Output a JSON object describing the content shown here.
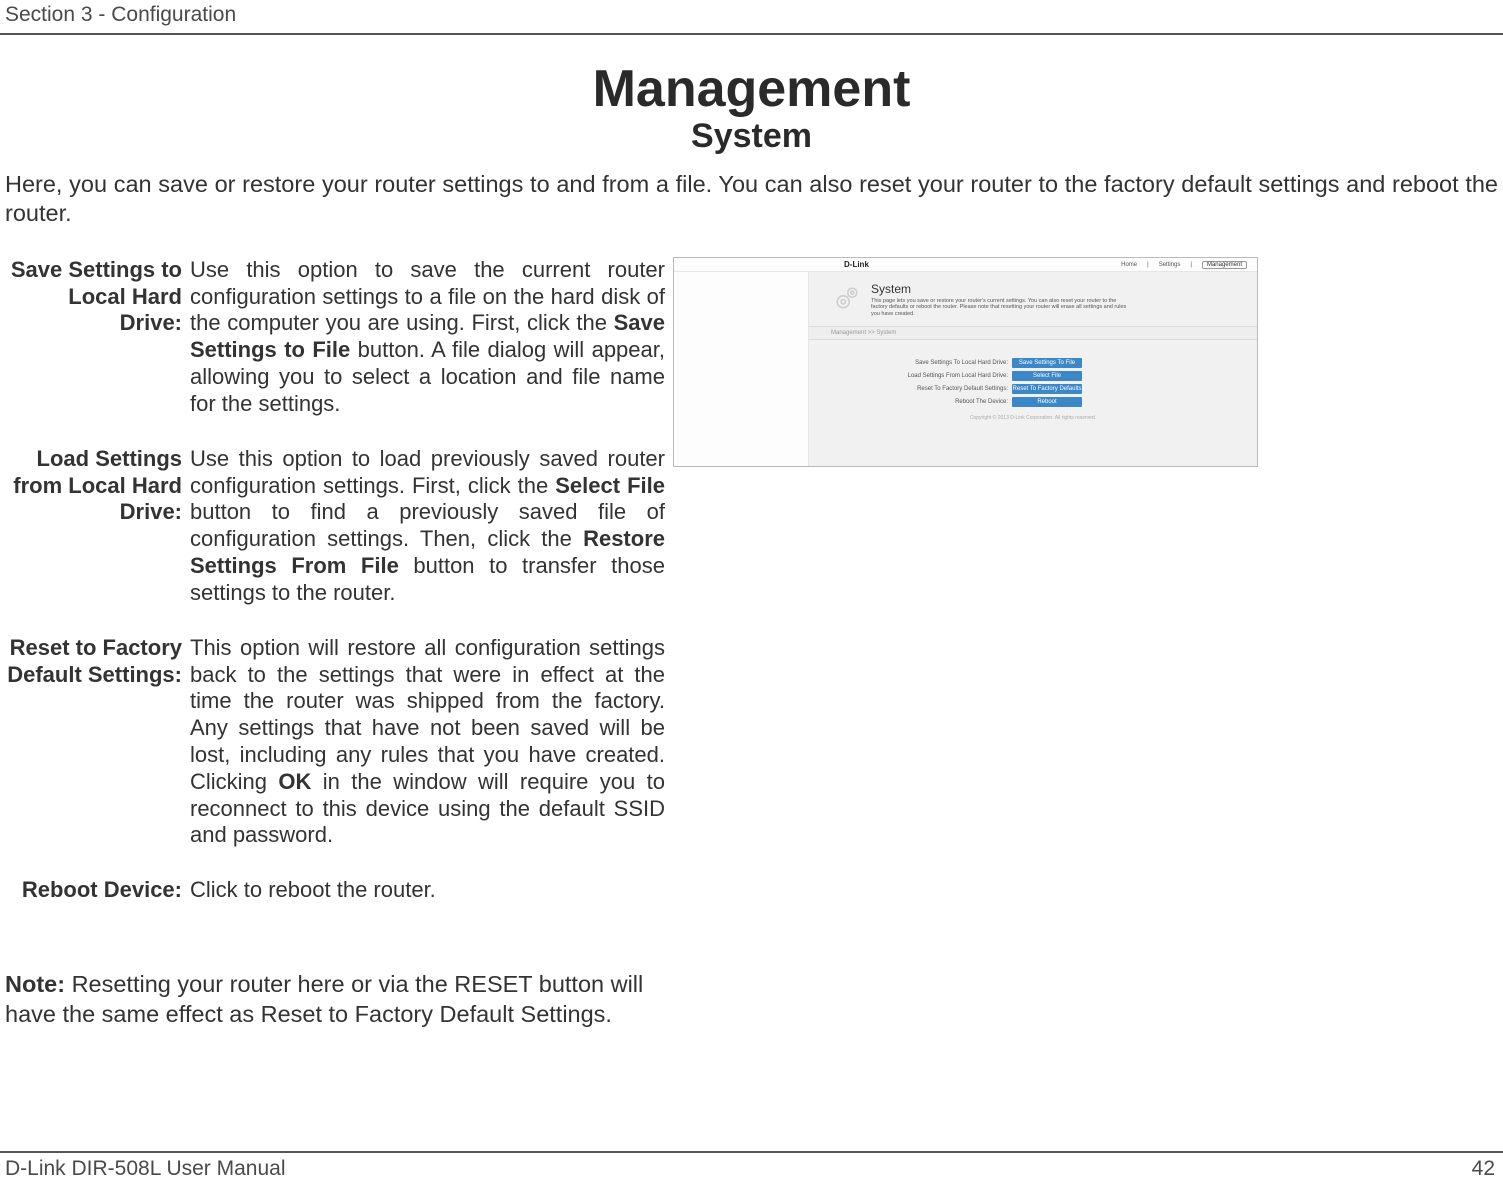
{
  "header": {
    "section": "Section 3 - Configuration"
  },
  "title": "Management",
  "subtitle": "System",
  "intro": "Here, you can save or restore your router settings to and from a file. You can also reset your router to the factory default settings and reboot the router.",
  "defs": {
    "save_label": "Save Settings to Local Hard Drive:",
    "save_desc_1": "Use this option to save the current router configuration settings to a file on the hard disk of the computer you are using. First, click the ",
    "save_desc_bold1": "Save Settings to File",
    "save_desc_2": " button. A file dialog will appear, allowing you to select a location and file name for the settings.",
    "load_label": "Load Settings from Local Hard Drive:",
    "load_desc_1": "Use this option to load previously saved router configuration settings. First, click the ",
    "load_desc_bold1": "Select File",
    "load_desc_2": " button to find a previously saved file of configuration settings. Then, click the ",
    "load_desc_bold2": "Restore Settings From File",
    "load_desc_3": " button to transfer those settings to the router.",
    "reset_label": "Reset to Factory Default Settings:",
    "reset_desc_1": "This option will restore all configuration settings back to the settings that were in effect at the time the router was shipped from the factory. Any settings that have not been saved will be lost, including any rules that you have created. Clicking ",
    "reset_desc_bold1": "OK",
    "reset_desc_2": " in the window will require you to reconnect to this device using the default SSID and password.",
    "reboot_label": "Reboot Device:",
    "reboot_desc": "Click to reboot the router."
  },
  "note": {
    "label": "Note:",
    "text": " Resetting your router here or via the RESET button will have the same effect as Reset to Factory Default Settings."
  },
  "footer": {
    "left": "D-Link DIR-508L User Manual",
    "right": "42"
  },
  "screenshot": {
    "logo": "D-Link",
    "nav_home": "Home",
    "nav_sep": "|",
    "nav_settings": "Settings",
    "nav_mgmt": "Management",
    "heading": "System",
    "desc": "This page lets you save or restore your router's current settings. You can also reset your router to the factory defaults or reboot the router. Please note that resetting your router will erase all settings and rules you have created.",
    "breadcrumb": "Management >> System",
    "row1_label": "Save Settings To Local Hard Drive:",
    "row1_btn": "Save Settings To File",
    "row2_label": "Load Settings From Local Hard Drive:",
    "row2_btn": "Select File",
    "row3_label": "Reset To Factory Default Settings:",
    "row3_btn": "Reset To Factory Defaults",
    "row4_label": "Reboot The Device:",
    "row4_btn": "Reboot",
    "copyright": "Copyright © 2013 D-Link Corporation. All rights reserved."
  }
}
